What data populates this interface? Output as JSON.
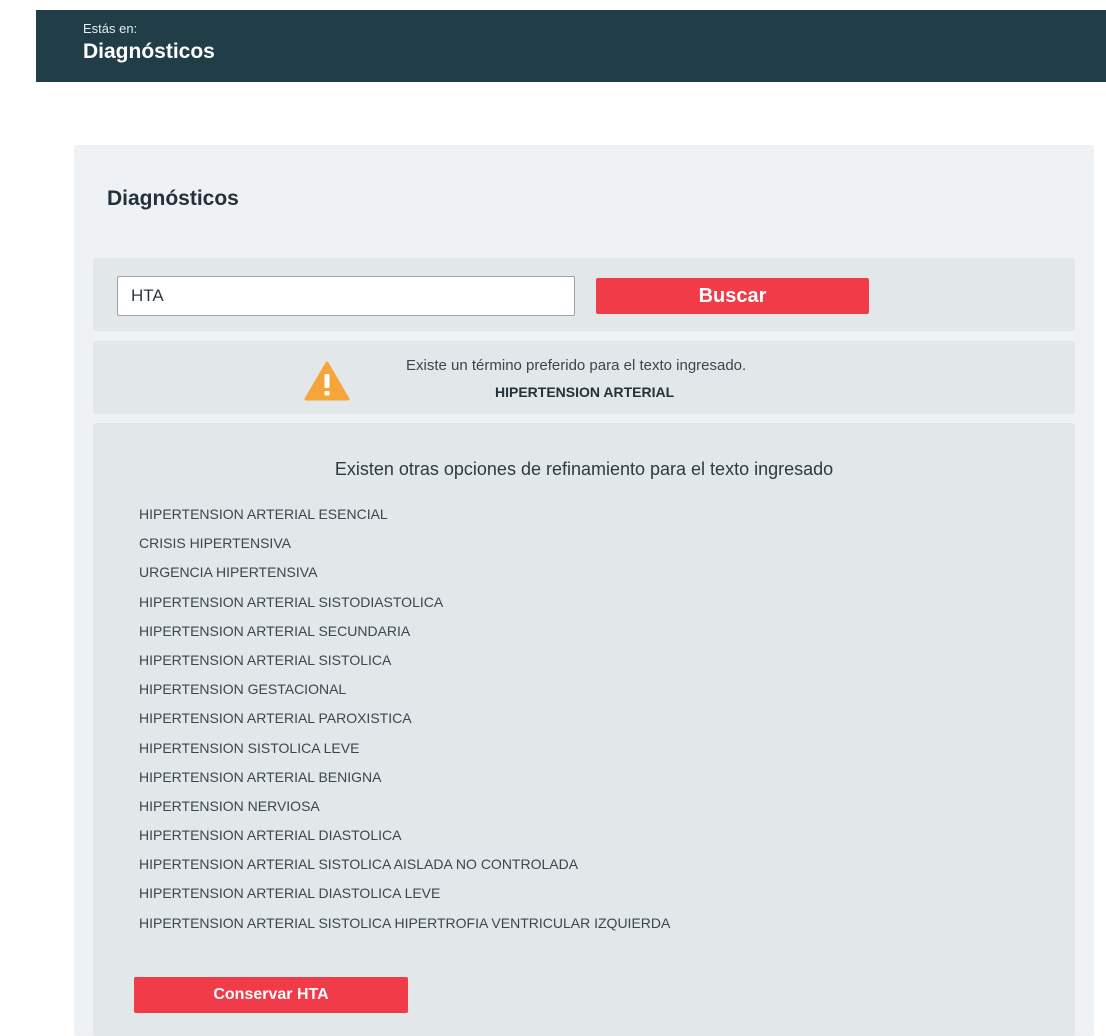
{
  "header": {
    "breadcrumb_label": "Estás en:",
    "title": "Diagnósticos"
  },
  "panel": {
    "title": "Diagnósticos"
  },
  "search": {
    "value": "HTA",
    "placeholder": "",
    "button_label": "Buscar"
  },
  "notice": {
    "icon": "warning-icon",
    "message": "Existe un término preferido para el texto ingresado.",
    "preferred_term": "HIPERTENSION ARTERIAL"
  },
  "refinement": {
    "heading": "Existen otras opciones de refinamiento para el texto ingresado",
    "options": [
      "HIPERTENSION ARTERIAL ESENCIAL",
      "CRISIS HIPERTENSIVA",
      "URGENCIA HIPERTENSIVA",
      "HIPERTENSION ARTERIAL SISTODIASTOLICA",
      "HIPERTENSION ARTERIAL SECUNDARIA",
      "HIPERTENSION ARTERIAL SISTOLICA",
      "HIPERTENSION GESTACIONAL",
      "HIPERTENSION ARTERIAL PAROXISTICA",
      "HIPERTENSION SISTOLICA LEVE",
      "HIPERTENSION ARTERIAL BENIGNA",
      "HIPERTENSION NERVIOSA",
      "HIPERTENSION ARTERIAL DIASTOLICA",
      "HIPERTENSION ARTERIAL SISTOLICA AISLADA NO CONTROLADA",
      "HIPERTENSION ARTERIAL DIASTOLICA LEVE",
      "HIPERTENSION ARTERIAL SISTOLICA HIPERTROFIA VENTRICULAR IZQUIERDA"
    ],
    "keep_button_label": "Conservar HTA"
  },
  "colors": {
    "header_bg": "#213d48",
    "accent": "#f23b48",
    "warning": "#f6a53a",
    "panel_bg": "#eef2f5",
    "box_bg": "#e2e7ea"
  }
}
